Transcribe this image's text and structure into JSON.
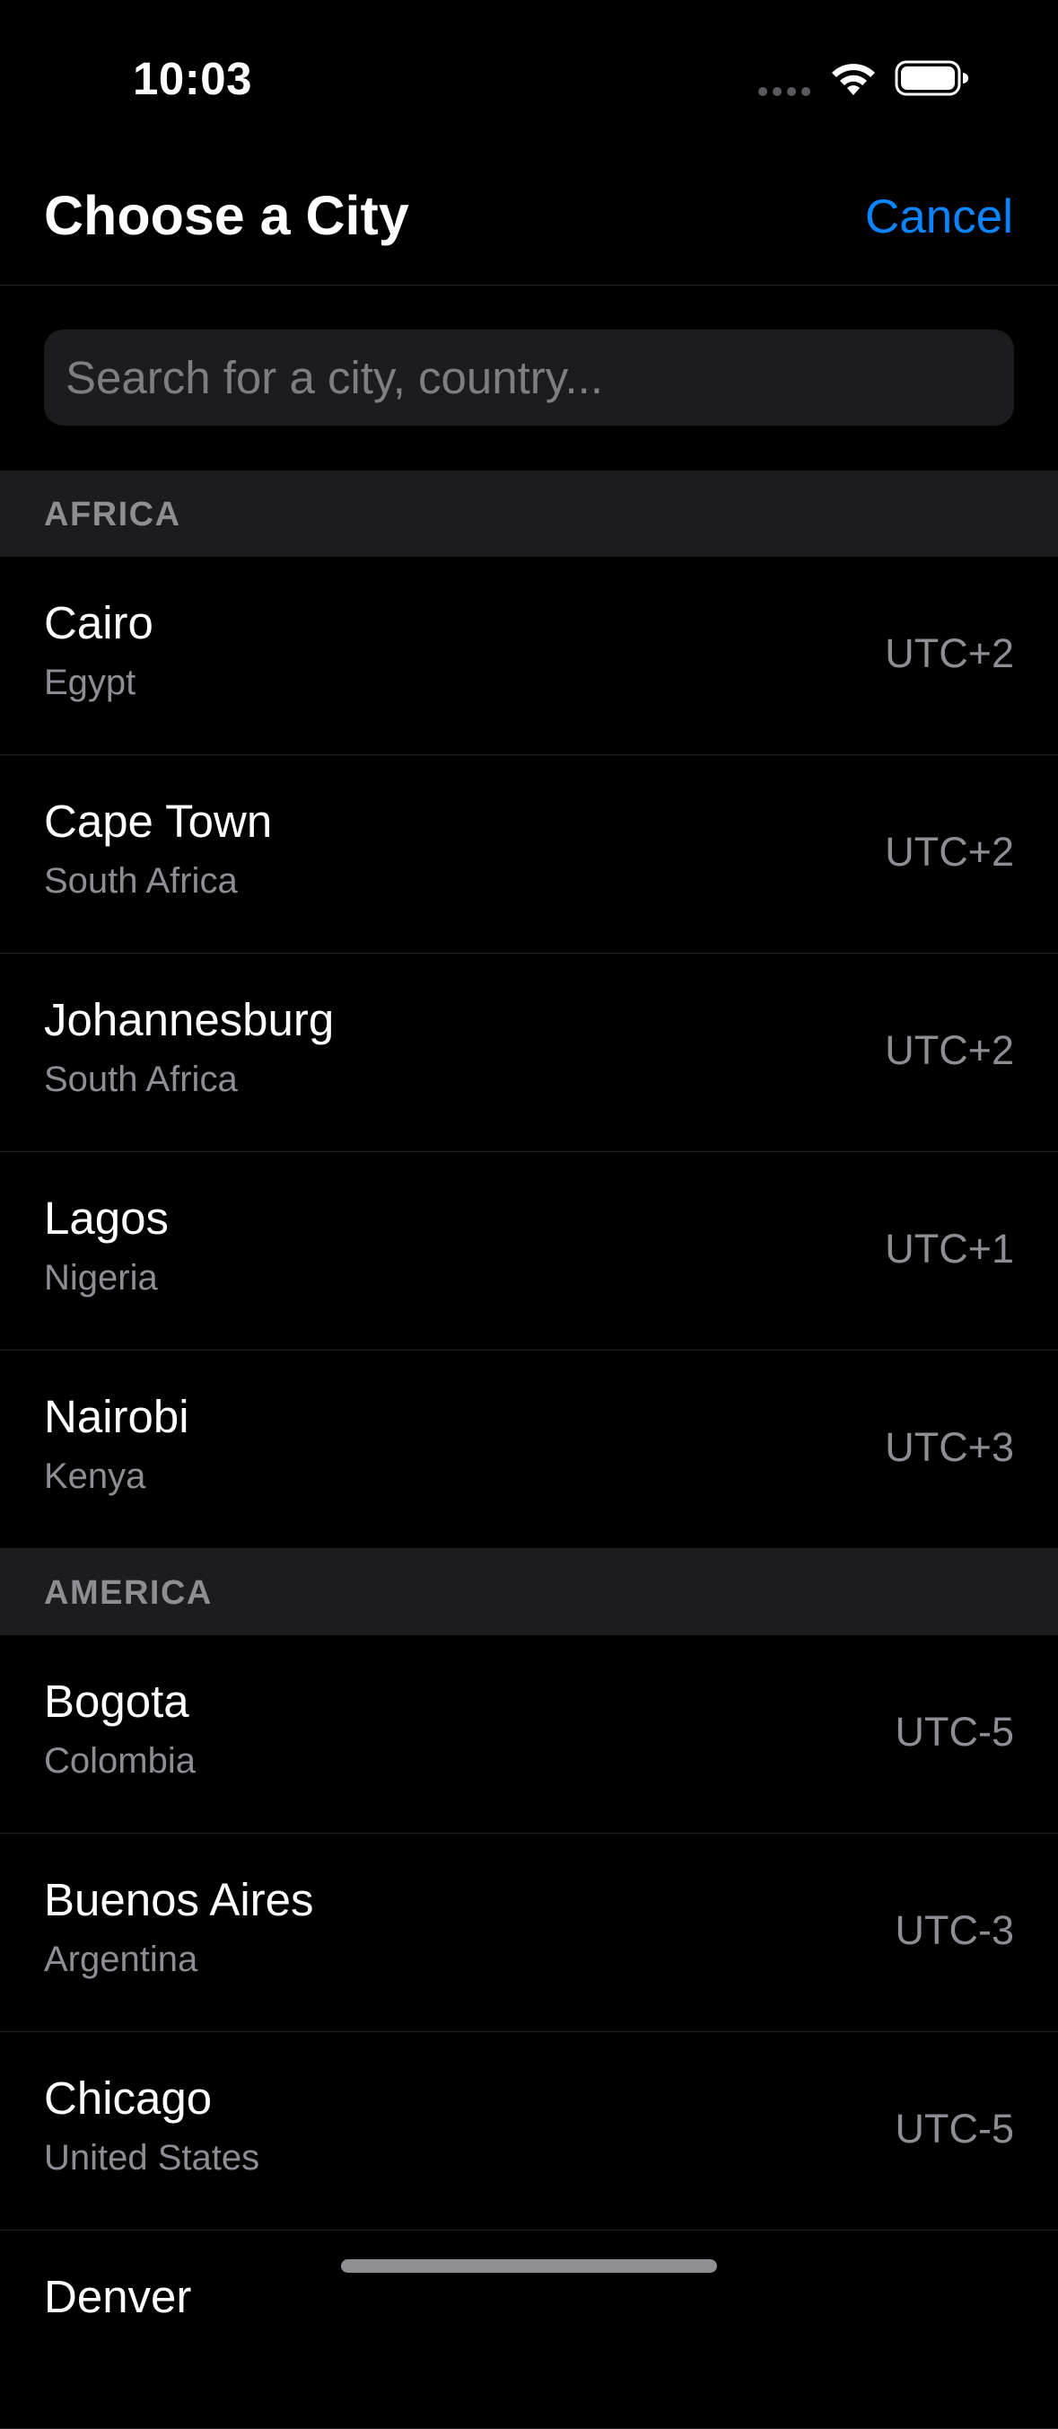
{
  "status_bar": {
    "time": "10:03",
    "signal_icon": "cellular-signal-dots-icon",
    "wifi_icon": "wifi-icon",
    "battery_icon": "battery-icon"
  },
  "nav": {
    "title": "Choose a City",
    "cancel_label": "Cancel"
  },
  "search": {
    "placeholder": "Search for a city, country...",
    "value": ""
  },
  "colors": {
    "background": "#000000",
    "accent": "#0a84ff",
    "section_background": "#1c1c1e",
    "secondary_text": "#8d8d93"
  },
  "sections": [
    {
      "header": "AFRICA",
      "rows": [
        {
          "city": "Cairo",
          "country": "Egypt",
          "offset": "UTC+2"
        },
        {
          "city": "Cape Town",
          "country": "South Africa",
          "offset": "UTC+2"
        },
        {
          "city": "Johannesburg",
          "country": "South Africa",
          "offset": "UTC+2"
        },
        {
          "city": "Lagos",
          "country": "Nigeria",
          "offset": "UTC+1"
        },
        {
          "city": "Nairobi",
          "country": "Kenya",
          "offset": "UTC+3"
        }
      ]
    },
    {
      "header": "AMERICA",
      "rows": [
        {
          "city": "Bogota",
          "country": "Colombia",
          "offset": "UTC-5"
        },
        {
          "city": "Buenos Aires",
          "country": "Argentina",
          "offset": "UTC-3"
        },
        {
          "city": "Chicago",
          "country": "United States",
          "offset": "UTC-5"
        },
        {
          "city": "Denver",
          "country": "",
          "offset": ""
        }
      ]
    }
  ]
}
